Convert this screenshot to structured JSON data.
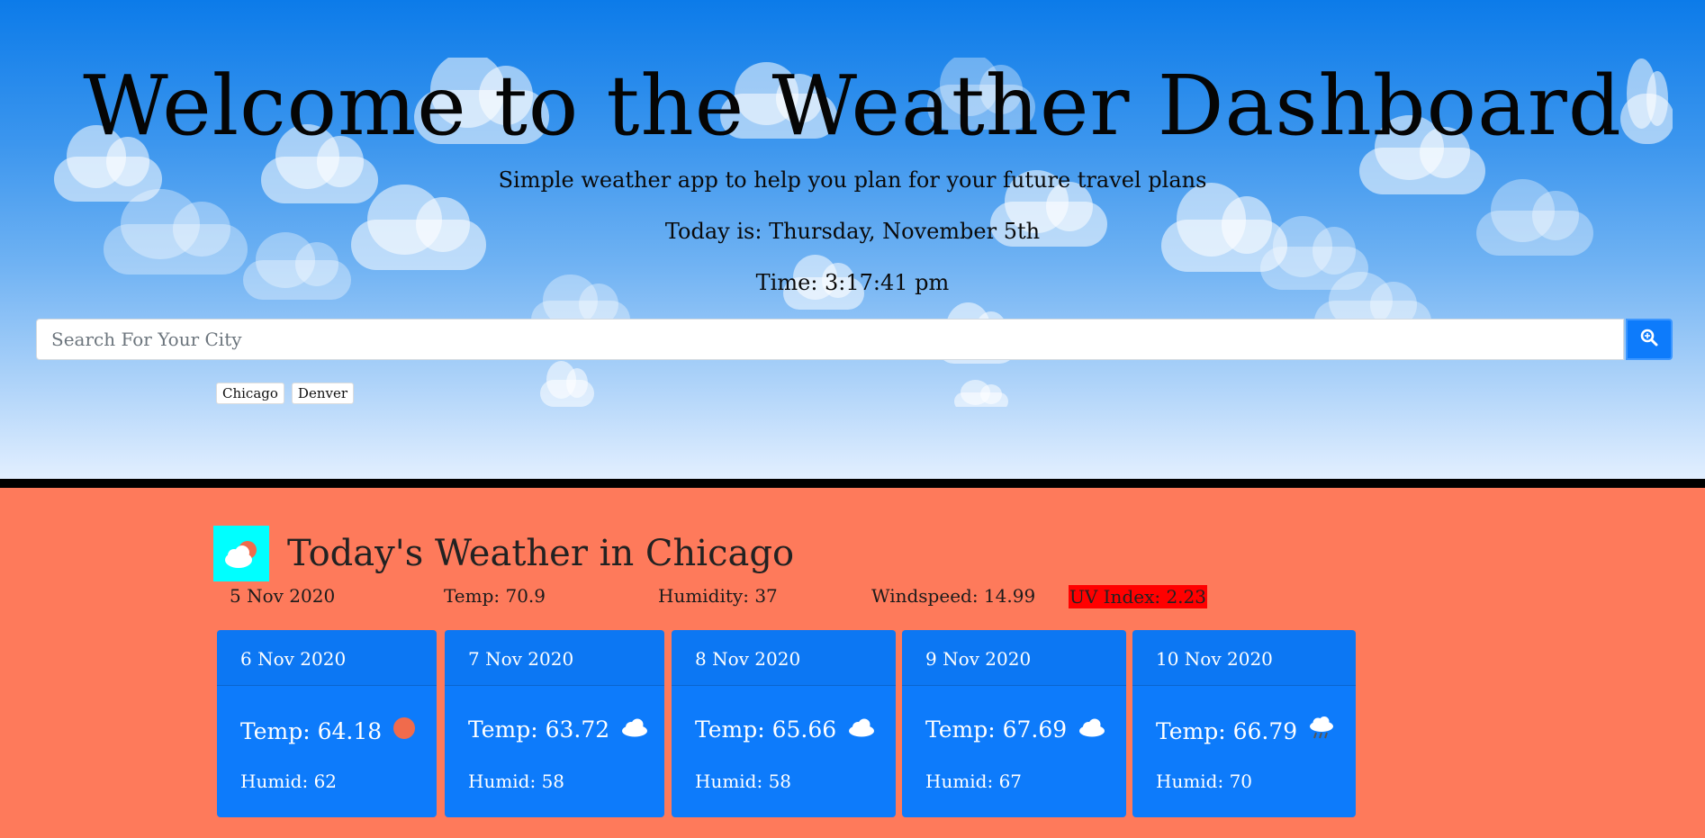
{
  "header": {
    "title": "Welcome to the Weather Dashboard",
    "subtitle": "Simple weather app to help you plan for your future travel plans",
    "today": "Today is: Thursday, November 5th",
    "time": "Time: 3:17:41 pm"
  },
  "search": {
    "placeholder": "Search For Your City",
    "button_icon": "search-icon"
  },
  "history": [
    "Chicago",
    "Denver"
  ],
  "current": {
    "title": "Today's Weather in Chicago",
    "icon": "partly-cloudy-icon",
    "date": "5 Nov 2020",
    "temp": "Temp: 70.9",
    "humidity": "Humidity: 37",
    "windspeed": "Windspeed: 14.99",
    "uv": "UV Index: 2.23"
  },
  "forecast": [
    {
      "date": "6 Nov 2020",
      "temp": "Temp: 64.18",
      "humid": "Humid: 62",
      "icon": "sun-icon"
    },
    {
      "date": "7 Nov 2020",
      "temp": "Temp: 63.72",
      "humid": "Humid: 58",
      "icon": "cloud-icon"
    },
    {
      "date": "8 Nov 2020",
      "temp": "Temp: 65.66",
      "humid": "Humid: 58",
      "icon": "cloud-icon"
    },
    {
      "date": "9 Nov 2020",
      "temp": "Temp: 67.69",
      "humid": "Humid: 67",
      "icon": "cloud-icon"
    },
    {
      "date": "10 Nov 2020",
      "temp": "Temp: 66.79",
      "humid": "Humid: 70",
      "icon": "rain-cloud-icon"
    }
  ],
  "colors": {
    "accent": "#0d7bfb",
    "background": "#fe7a5b",
    "uv_badge": "#ff0000",
    "icon_bg": "#00ffff"
  }
}
